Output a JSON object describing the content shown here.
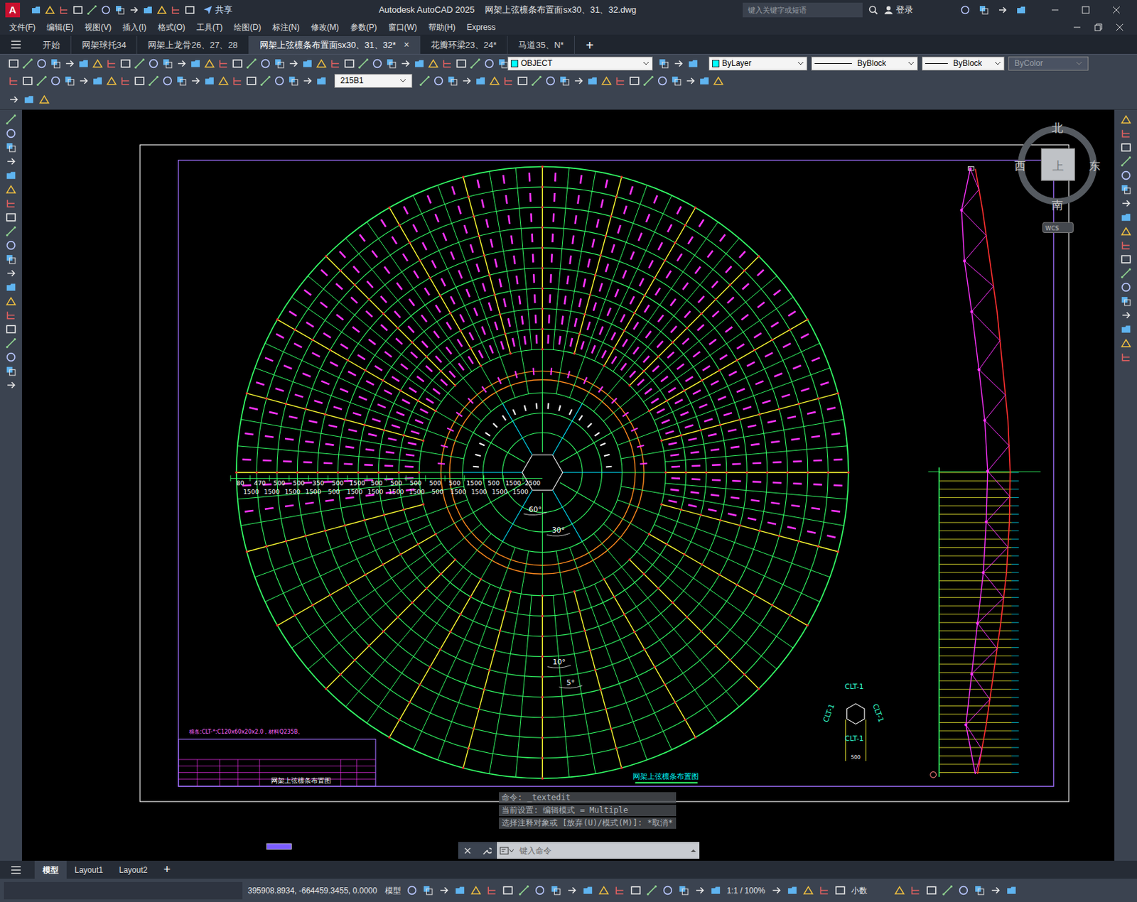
{
  "app": {
    "logo": "A",
    "title": "Autodesk AutoCAD 2025",
    "file": "网架上弦檩条布置面sx30、31、32.dwg",
    "share": "共享",
    "search_placeholder": "键入关键字或短语",
    "login": "登录"
  },
  "menu": [
    "文件(F)",
    "编辑(E)",
    "视图(V)",
    "插入(I)",
    "格式(O)",
    "工具(T)",
    "绘图(D)",
    "标注(N)",
    "修改(M)",
    "参数(P)",
    "窗口(W)",
    "帮助(H)",
    "Express"
  ],
  "doc_tabs": [
    {
      "label": "开始",
      "selected": false
    },
    {
      "label": "网架球托34",
      "selected": false
    },
    {
      "label": "网架上龙骨26、27、28",
      "selected": false
    },
    {
      "label": "网架上弦檩条布置面sx30、31、32*",
      "selected": true
    },
    {
      "label": "花瓣环梁23、24*",
      "selected": false
    },
    {
      "label": "马道35、N*",
      "selected": false
    }
  ],
  "tab_close": "×",
  "tab_add": "+",
  "toolbar": {
    "layer": "OBJECT",
    "color": "ByLayer",
    "linetype": "ByBlock",
    "lineweight": "ByBlock",
    "plotstyle": {
      "label": "ByColor",
      "disabled": true
    },
    "dimstyle": "215B1"
  },
  "viewcube": {
    "north": "北",
    "east": "东",
    "south": "南",
    "west": "西",
    "top": "上",
    "wcs": "WCS"
  },
  "drawing": {
    "dims_row1": [
      "80",
      "470",
      "500",
      "500",
      "350",
      "500",
      "1500",
      "500",
      "500",
      "500",
      "500",
      "500",
      "1500",
      "500",
      "1500",
      "2500"
    ],
    "dims_row2": [
      "1500",
      "1500",
      "1500",
      "1500",
      "500",
      "1500",
      "1500",
      "1500",
      "1500",
      "500",
      "1500",
      "1500",
      "1500",
      "1500"
    ],
    "angles": [
      "60°",
      "30°",
      "10°",
      "5°"
    ],
    "note": "檩条:CLT-*:C120x60x20x2.0，材料Q235B。",
    "title": "网架上弦檩条布置图",
    "titleblock_name": "网架上弦檩条布置图",
    "clt_labels": [
      "CLT-1",
      "CLT-1",
      "CLT-1",
      "CLT-1"
    ],
    "clt_dim": "500"
  },
  "command": {
    "history": [
      "命令: _textedit",
      "当前设置: 编辑模式 = Multiple",
      "选择注释对象或 [放弃(U)/模式(M)]: *取消*"
    ],
    "placeholder": "键入命令"
  },
  "layout_tabs": [
    {
      "label": "模型",
      "selected": true
    },
    {
      "label": "Layout1",
      "selected": false
    },
    {
      "label": "Layout2",
      "selected": false
    }
  ],
  "layout_add": "+",
  "status": {
    "coords": "395908.8934, -664459.3455, 0.0000",
    "space": "模型",
    "scale": "1:1 / 100%",
    "units": "小数"
  }
}
